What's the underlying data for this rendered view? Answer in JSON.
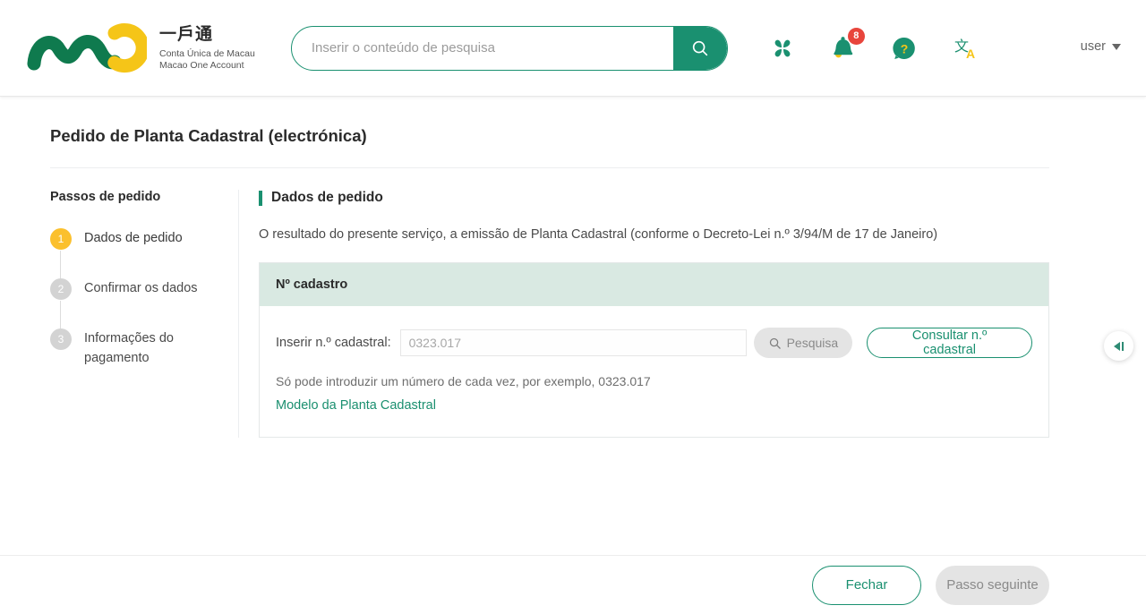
{
  "header": {
    "logo": {
      "icon": "macao-one-account-logo",
      "cn_title": "一戶通",
      "pt_subtitle": "Conta Única de Macau",
      "en_subtitle": "Macao One Account"
    },
    "search": {
      "placeholder": "Inserir o conteúdo de pesquisa",
      "value": "",
      "button_icon": "search-icon"
    },
    "icons": [
      {
        "name": "apps-grid-icon",
        "label": ""
      },
      {
        "name": "notification-bell-icon",
        "badge": "8"
      },
      {
        "name": "help-chat-icon",
        "label": "?"
      },
      {
        "name": "language-translate-icon",
        "label": "文A"
      }
    ],
    "user": {
      "label": "user",
      "caret_icon": "chevron-down-icon"
    }
  },
  "page": {
    "title": "Pedido de Planta Cadastral (electrónica)"
  },
  "sidebar": {
    "title": "Passos de pedido",
    "steps": [
      {
        "number": "1",
        "label": "Dados de pedido",
        "state": "active"
      },
      {
        "number": "2",
        "label": "Confirmar os dados",
        "state": "inactive"
      },
      {
        "number": "3",
        "label": "Informações do pagamento",
        "state": "inactive"
      }
    ]
  },
  "main": {
    "section_title": "Dados de pedido",
    "description": "O resultado do presente serviço, a emissão de Planta Cadastral (conforme o Decreto-Lei n.º 3/94/M de 17 de Janeiro)",
    "card": {
      "head": "Nº cadastro",
      "field_label": "Inserir n.º cadastral:",
      "input_value": "",
      "input_placeholder": "0323.017",
      "search_button": "Pesquisa",
      "search_button_icon": "search-icon",
      "consult_button": "Consultar n.º cadastral",
      "hint": "Só pode introduzir um número de cada vez, por exemplo, 0323.017",
      "link": "Modelo da Planta Cadastral"
    }
  },
  "side_tab": {
    "icon": "collapse-panel-icon"
  },
  "footer": {
    "close_button": "Fechar",
    "next_button": "Passo seguinte"
  },
  "colors": {
    "brand_green": "#1a9070",
    "brand_yellow": "#fbc02d",
    "badge_red": "#e8453c",
    "panel_green": "#d9e9e2"
  }
}
